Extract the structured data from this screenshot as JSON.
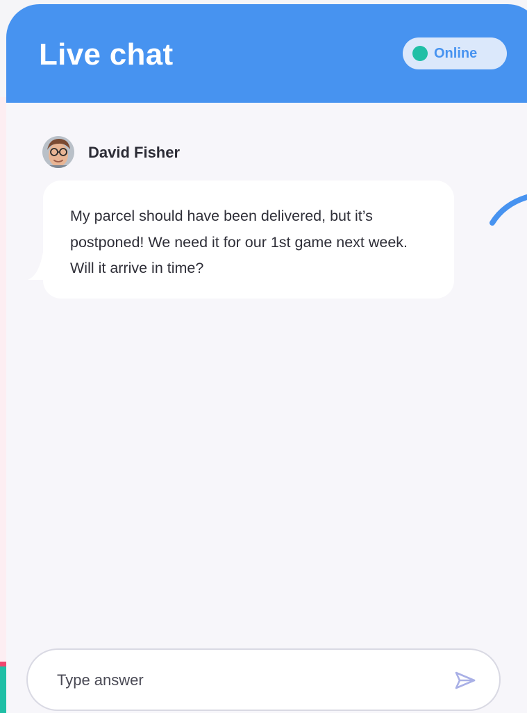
{
  "header": {
    "title": "Live chat",
    "status_label": "Online"
  },
  "message": {
    "sender_name": "David Fisher",
    "text": "My parcel should have been delivered, but it’s postponed! We need it for our 1st game next week. Will it arrive in time?"
  },
  "composer": {
    "placeholder": "Type answer"
  },
  "icons": {
    "status": "status-dot-icon",
    "send": "send-icon",
    "spinner": "loading-arc-icon"
  },
  "colors": {
    "accent": "#4793f0",
    "online": "#1fbfa6",
    "background": "#f7f6fa",
    "bubble": "#ffffff",
    "edge_pink": "#f0476f",
    "edge_teal": "#1fbfa6"
  }
}
